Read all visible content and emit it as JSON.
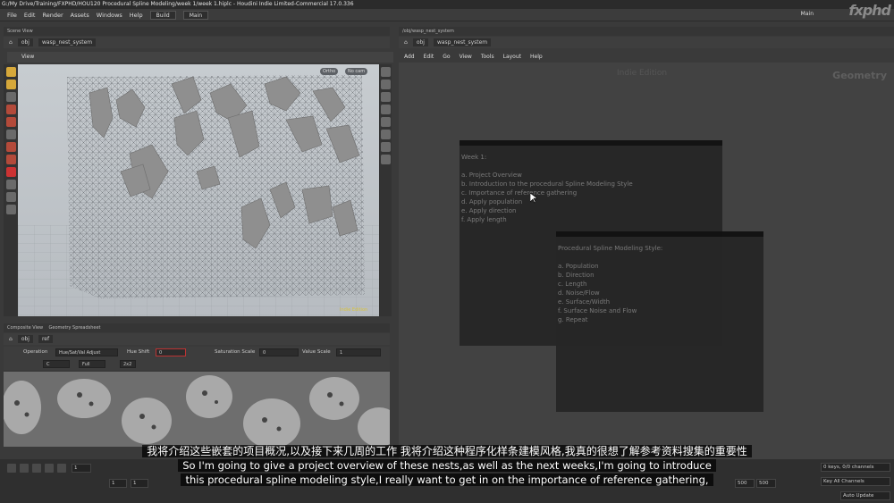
{
  "window": {
    "title": "G:/My Drive/Training/FXPHD/HOU120 Procedural Spline Modeling/week 1/week 1.hiplc - Houdini Indie Limited-Commercial 17.0.336"
  },
  "menubar": {
    "items": [
      "File",
      "Edit",
      "Render",
      "Assets",
      "Windows",
      "Help"
    ],
    "build": "Build",
    "main_left": "Main",
    "main_right": "Main"
  },
  "logo": "fxphd",
  "scene": {
    "tab": "Scene View",
    "path": "obj",
    "node": "wasp_nest_system",
    "view_label": "View",
    "ortho": "Ortho",
    "camera": "No cam"
  },
  "composite": {
    "tabs": [
      "Composite View",
      "Geometry Spreadsheet"
    ],
    "path": "obj",
    "node": "ref",
    "operation_label": "Operation",
    "operation_value": "Hue/Sat/Val Adjust",
    "hue_label": "Hue Shift",
    "hue_value": "0",
    "sat_label": "Saturation Scale",
    "sat_value": "0",
    "val_label": "Value Scale",
    "val_value": "1",
    "channel": "C",
    "res": "Full",
    "grid": "2x2"
  },
  "network": {
    "tab": "/obj/wasp_nest_system",
    "path": "obj",
    "node": "wasp_nest_system",
    "menu": [
      "Add",
      "Edit",
      "Go",
      "View",
      "Tools",
      "Layout",
      "Help"
    ],
    "watermark_edition": "Indie Edition",
    "watermark_context": "Geometry",
    "sticky1": "Week 1:\n\na. Project Overview\nb. Introduction to the procedural Spline Modeling Style\nc. Importance of reference gathering\nd. Apply population\ne. Apply direction\nf. Apply length",
    "sticky2": "Procedural Spline Modeling Style:\n\na. Population\nb. Direction\nc. Length\nd. Noise/Flow\ne. Surface/Width\nf. Surface Noise and Flow\ng. Repeat"
  },
  "timeline": {
    "frame": "1",
    "start": "1",
    "start2": "1",
    "end": "500",
    "end2": "500",
    "keys": "0 keys, 0/0 channels",
    "key_all": "Key All Channels",
    "auto_update": "Auto Update"
  },
  "subtitles": {
    "cn": "我将介绍这些嵌套的项目概况,以及接下来几周的工作 我将介绍这种程序化样条建模风格,我真的很想了解参考资料搜集的重要性",
    "en1": "So I'm going to give a project overview of these nests,as well as the next weeks,I'm going to introduce",
    "en2": "this procedural spline modeling style,I really want to get in on the importance of reference gathering,"
  },
  "colors": {
    "viewport_bg": "#c0c5ca",
    "net_bg": "#424242",
    "sticky_bg": "#262626"
  }
}
